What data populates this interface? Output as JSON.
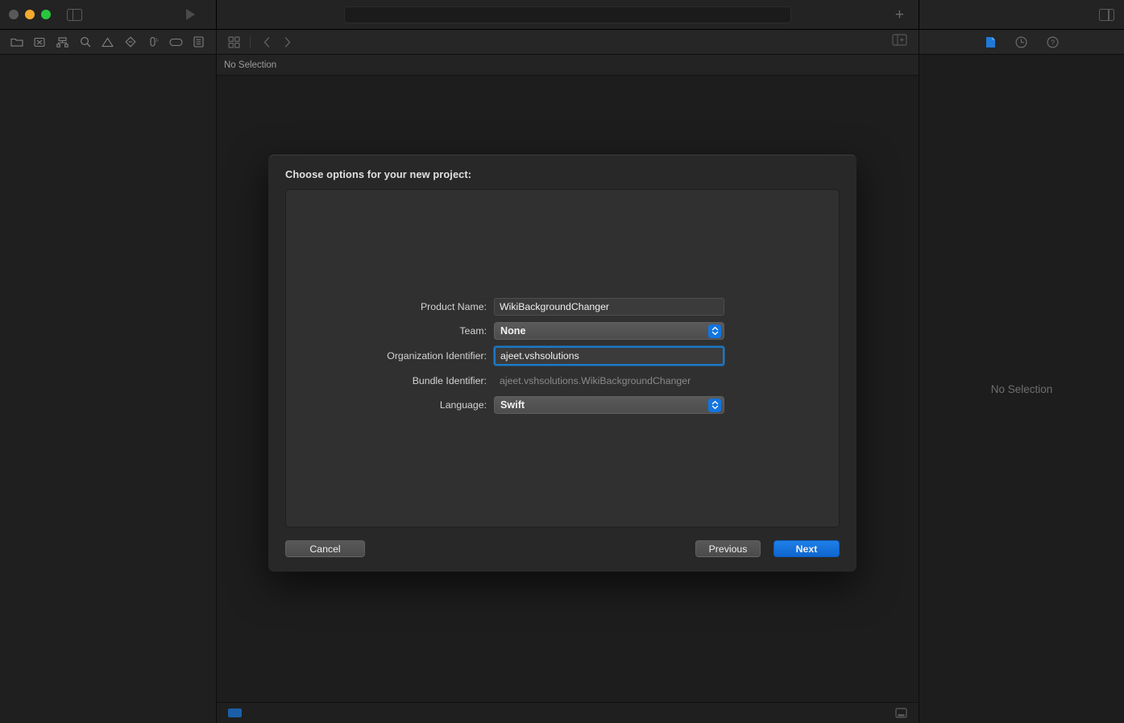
{
  "window": {
    "traffic_lights": [
      "close",
      "minimize",
      "maximize"
    ],
    "sidebar_toggle_icon": "sidebar-left-icon",
    "run_icon": "play-icon",
    "add_icon": "plus-icon",
    "inspector_toggle_icon": "sidebar-right-icon"
  },
  "navigator_toolbar": {
    "items": [
      {
        "icon": "folder-icon",
        "name": "project-navigator"
      },
      {
        "icon": "source-control-icon",
        "name": "source-control-navigator"
      },
      {
        "icon": "symbol-hierarchy-icon",
        "name": "symbol-navigator"
      },
      {
        "icon": "search-icon",
        "name": "find-navigator"
      },
      {
        "icon": "warning-triangle-icon",
        "name": "issue-navigator"
      },
      {
        "icon": "diamond-icon",
        "name": "test-navigator"
      },
      {
        "icon": "debug-icon",
        "name": "debug-navigator"
      },
      {
        "icon": "breakpoint-tag-icon",
        "name": "breakpoint-navigator"
      },
      {
        "icon": "report-list-icon",
        "name": "report-navigator"
      }
    ]
  },
  "editor_toolbar": {
    "grid_icon": "grid-icon",
    "back_icon": "chevron-left-icon",
    "forward_icon": "chevron-right-icon",
    "add_editor_icon": "add-editor-icon"
  },
  "jumpbar": {
    "label": "No Selection"
  },
  "inspector_toolbar": {
    "items": [
      {
        "icon": "file-inspector-icon",
        "name": "file-inspector",
        "active": true
      },
      {
        "icon": "history-clock-icon",
        "name": "history-inspector",
        "active": false
      },
      {
        "icon": "help-question-icon",
        "name": "quick-help-inspector",
        "active": false
      }
    ]
  },
  "inspector": {
    "empty_label": "No Selection"
  },
  "statusbar": {
    "left_indicator": "activity-chip",
    "console_icon": "console-toggle-icon"
  },
  "dialog": {
    "title": "Choose options for your new project:",
    "fields": [
      {
        "label": "Product Name:",
        "value": "WikiBackgroundChanger",
        "type": "text",
        "focused": false,
        "name": "product-name"
      },
      {
        "label": "Team:",
        "value": "None",
        "type": "select",
        "focused": false,
        "name": "team"
      },
      {
        "label": "Organization Identifier:",
        "value": "ajeet.vshsolutions",
        "type": "text",
        "focused": true,
        "name": "organization-identifier"
      },
      {
        "label": "Bundle Identifier:",
        "value": "ajeet.vshsolutions.WikiBackgroundChanger",
        "type": "static",
        "focused": false,
        "name": "bundle-identifier"
      },
      {
        "label": "Language:",
        "value": "Swift",
        "type": "select",
        "focused": false,
        "name": "language"
      }
    ],
    "buttons": {
      "cancel": "Cancel",
      "previous": "Previous",
      "next": "Next"
    }
  },
  "colors": {
    "accent_blue": "#1275e0",
    "focus_ring": "#1d78c4",
    "next_button": "#0f66d0",
    "window_bg": "#1d1d1d",
    "dialog_bg": "#282828"
  }
}
